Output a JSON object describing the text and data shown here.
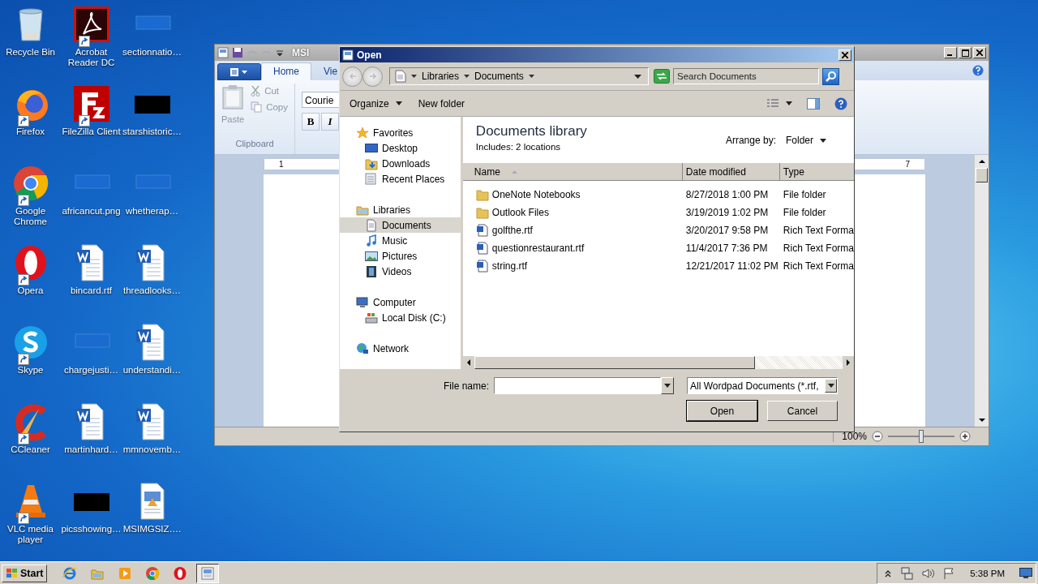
{
  "desktop_icons": [
    {
      "label": "Recycle Bin",
      "kind": "recycle",
      "shortcut": false
    },
    {
      "label": "Acrobat Reader DC",
      "kind": "acrobat",
      "shortcut": true
    },
    {
      "label": "sectionnatio…",
      "kind": "blank",
      "shortcut": false
    },
    {
      "label": "Firefox",
      "kind": "firefox",
      "shortcut": true
    },
    {
      "label": "FileZilla Client",
      "kind": "filezilla",
      "shortcut": true
    },
    {
      "label": "starshistoric…",
      "kind": "black",
      "shortcut": false
    },
    {
      "label": "Google Chrome",
      "kind": "chrome",
      "shortcut": true
    },
    {
      "label": "africancut.png",
      "kind": "blank",
      "shortcut": false
    },
    {
      "label": "whetherap…",
      "kind": "blank",
      "shortcut": false
    },
    {
      "label": "Opera",
      "kind": "opera",
      "shortcut": true
    },
    {
      "label": "bincard.rtf",
      "kind": "word",
      "shortcut": false
    },
    {
      "label": "threadlooks…",
      "kind": "word",
      "shortcut": false
    },
    {
      "label": "Skype",
      "kind": "skype",
      "shortcut": true
    },
    {
      "label": "chargejusti…",
      "kind": "blank",
      "shortcut": false
    },
    {
      "label": "understandi…",
      "kind": "word",
      "shortcut": false
    },
    {
      "label": "CCleaner",
      "kind": "ccleaner",
      "shortcut": true
    },
    {
      "label": "martinhard…",
      "kind": "word",
      "shortcut": false
    },
    {
      "label": "mmnovemb…",
      "kind": "word",
      "shortcut": false
    },
    {
      "label": "VLC media player",
      "kind": "vlc",
      "shortcut": true
    },
    {
      "label": "picsshowing…",
      "kind": "black",
      "shortcut": false
    },
    {
      "label": "MSIMGSIZ….",
      "kind": "wordpad",
      "shortcut": false
    }
  ],
  "wordpad": {
    "title": "MSI",
    "tabs": [
      {
        "label": "Home",
        "selected": true
      },
      {
        "label": "Vie",
        "selected": false
      }
    ],
    "clipboard": {
      "paste": {
        "label": "Paste",
        "disabled": true
      },
      "cut": {
        "label": "Cut",
        "disabled": true
      },
      "copy": {
        "label": "Copy",
        "disabled": true
      },
      "group": "Clipboard"
    },
    "font": {
      "name": "Courie",
      "bold": "B",
      "italic": "I"
    },
    "ruler": [
      "1",
      "7"
    ],
    "zoom": {
      "reading": "100%",
      "level": 0.5
    }
  },
  "open_dialog": {
    "title": "Open",
    "breadcrumb": [
      "Libraries",
      "Documents"
    ],
    "search": {
      "placeholder": "Search Documents"
    },
    "toolbar": [
      "Organize",
      "New folder"
    ],
    "nav": [
      {
        "label": "Favorites",
        "kind": "star",
        "selected": false,
        "children": [
          {
            "label": "Desktop",
            "kind": "desktop",
            "selected": false
          },
          {
            "label": "Downloads",
            "kind": "downloads",
            "selected": false
          },
          {
            "label": "Recent Places",
            "kind": "recent",
            "selected": false
          }
        ]
      },
      {
        "label": "Libraries",
        "kind": "libraries",
        "selected": false,
        "children": [
          {
            "label": "Documents",
            "kind": "documents",
            "selected": true
          },
          {
            "label": "Music",
            "kind": "music",
            "selected": false
          },
          {
            "label": "Pictures",
            "kind": "pictures",
            "selected": false
          },
          {
            "label": "Videos",
            "kind": "videos",
            "selected": false
          }
        ]
      },
      {
        "label": "Computer",
        "kind": "computer",
        "selected": false,
        "children": [
          {
            "label": "Local Disk (C:)",
            "kind": "disk",
            "selected": false
          }
        ]
      },
      {
        "label": "Network",
        "kind": "network",
        "selected": false
      }
    ],
    "library": {
      "title": "Documents library",
      "includes": "Includes:  2 locations",
      "arrange_label": "Arrange by:",
      "arrange_value": "Folder"
    },
    "columns": [
      "Name",
      "Date modified",
      "Type"
    ],
    "files": [
      {
        "name": "OneNote Notebooks",
        "kind": "folder",
        "date": "8/27/2018 1:00 PM",
        "type": "File folder"
      },
      {
        "name": "Outlook Files",
        "kind": "folder",
        "date": "3/19/2019 1:02 PM",
        "type": "File folder"
      },
      {
        "name": "golfthe.rtf",
        "kind": "rtf",
        "date": "3/20/2017 9:58 PM",
        "type": "Rich Text Forma"
      },
      {
        "name": "questionrestaurant.rtf",
        "kind": "rtf",
        "date": "11/4/2017 7:36 PM",
        "type": "Rich Text Forma"
      },
      {
        "name": "string.rtf",
        "kind": "rtf",
        "date": "12/21/2017 11:02 PM",
        "type": "Rich Text Forma"
      }
    ],
    "file_name_label": "File name:",
    "file_type": "All Wordpad Documents (*.rtf,",
    "buttons": [
      "Open",
      "Cancel"
    ]
  },
  "taskbar": {
    "start": "Start",
    "apps": [
      {
        "kind": "ie",
        "active": false
      },
      {
        "kind": "explorer",
        "active": false
      },
      {
        "kind": "media",
        "active": false
      },
      {
        "kind": "chrome",
        "active": false
      },
      {
        "kind": "opera",
        "active": false
      },
      {
        "kind": "wordpad",
        "active": true
      }
    ],
    "clock": "5:38 PM"
  }
}
